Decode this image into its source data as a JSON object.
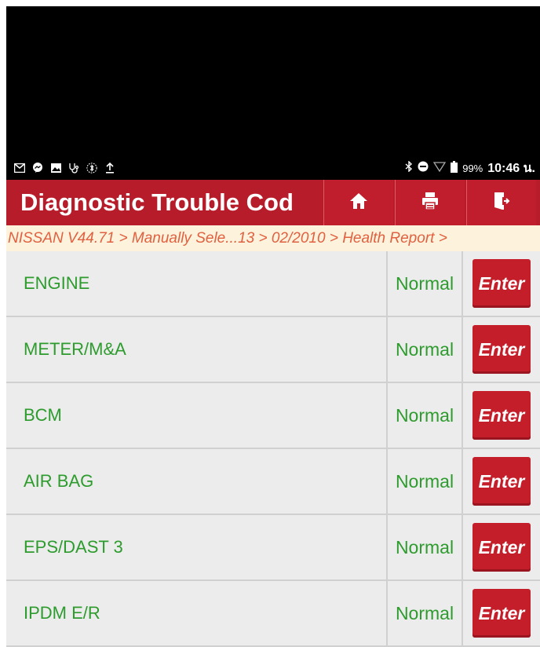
{
  "status_bar": {
    "left_icons": [
      "gmail-icon",
      "messenger-icon",
      "gallery-icon",
      "stethoscope-icon",
      "bluetooth-settings-icon",
      "upload-icon"
    ],
    "right_icons": [
      "bluetooth-icon",
      "do-not-disturb-icon",
      "wifi-icon",
      "battery-icon"
    ],
    "battery": "99%",
    "time": "10:46 น."
  },
  "header": {
    "title": "Diagnostic Trouble Cod",
    "buttons": [
      {
        "name": "home-button",
        "icon": "home-icon"
      },
      {
        "name": "print-button",
        "icon": "printer-icon"
      },
      {
        "name": "exit-button",
        "icon": "exit-icon"
      }
    ]
  },
  "breadcrumb": "NISSAN V44.71 > Manually Sele...13 > 02/2010 > Health Report >",
  "rows": [
    {
      "system": "ENGINE",
      "status": "Normal",
      "action": "Enter"
    },
    {
      "system": "METER/M&A",
      "status": "Normal",
      "action": "Enter"
    },
    {
      "system": "BCM",
      "status": "Normal",
      "action": "Enter"
    },
    {
      "system": "AIR BAG",
      "status": "Normal",
      "action": "Enter"
    },
    {
      "system": "EPS/DAST 3",
      "status": "Normal",
      "action": "Enter"
    },
    {
      "system": "IPDM E/R",
      "status": "Normal",
      "action": "Enter"
    }
  ],
  "colors": {
    "header_red": "#b61c29",
    "status_green": "#2d9b2d",
    "breadcrumb_text": "#e06040",
    "breadcrumb_bg": "#fdf3dc"
  }
}
